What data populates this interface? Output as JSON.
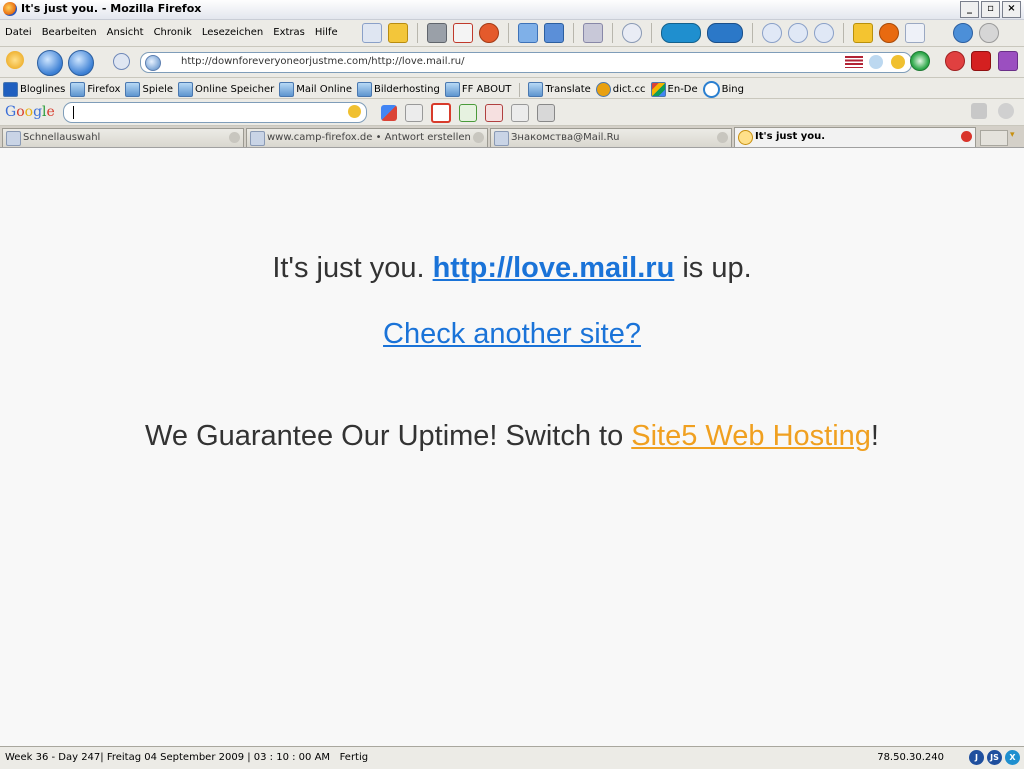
{
  "window": {
    "title": "It's just you. - Mozilla Firefox"
  },
  "menu": [
    "Datei",
    "Bearbeiten",
    "Ansicht",
    "Chronik",
    "Lesezeichen",
    "Extras",
    "Hilfe"
  ],
  "address": {
    "url": "http://downforeveryoneorjustme.com/http://love.mail.ru/"
  },
  "bookmarks": [
    "Bloglines",
    "Firefox",
    "Spiele",
    "Online Speicher",
    "Mail Online",
    "Bilderhosting",
    "FF ABOUT",
    "Translate",
    "dict.cc",
    "En-De",
    "Bing"
  ],
  "google_toolbar": {
    "logo": "Google",
    "query": ""
  },
  "tabs": [
    {
      "label": "Schnellauswahl",
      "active": false
    },
    {
      "label": "www.camp-firefox.de • Antwort erstellen",
      "active": false
    },
    {
      "label": "Знакомства@Mail.Ru",
      "active": false
    },
    {
      "label": "It's just you.",
      "active": true
    }
  ],
  "page": {
    "line1_prefix": "It's just you.",
    "line1_link": "http://love.mail.ru",
    "line1_suffix": "is up.",
    "check_link": "Check another site?",
    "line3_prefix": "We Guarantee Our Uptime! Switch to ",
    "line3_link": "Site5 Web Hosting",
    "line3_suffix": "!"
  },
  "status": {
    "left": "Week 36 - Day 247| Freitag 04 September 2009 | 03 : 10 : 00 AM   Fertig",
    "ip": "78.50.30.240",
    "icons": [
      "J",
      "JS",
      "X"
    ]
  }
}
